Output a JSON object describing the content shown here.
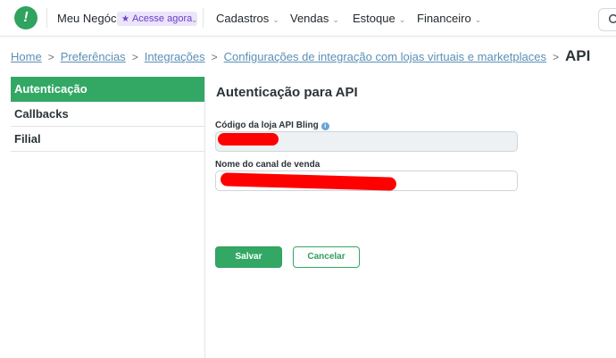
{
  "topnav": {
    "logo_text": "!",
    "items": [
      {
        "label": "Meu Negócio",
        "chevron": "⌄"
      },
      {
        "label": "Cadastros",
        "chevron": "⌄"
      },
      {
        "label": "Vendas",
        "chevron": "⌄"
      },
      {
        "label": "Estoque",
        "chevron": "⌄"
      },
      {
        "label": "Financeiro",
        "chevron": "⌄"
      }
    ],
    "badge": {
      "icon": "star-icon",
      "label": "Acesse agora"
    },
    "search_icon": "search-icon"
  },
  "breadcrumb": {
    "items": [
      "Home",
      "Preferências",
      "Integrações",
      "Configurações de integração com lojas virtuais e marketplaces"
    ],
    "separator": ">",
    "current": "API"
  },
  "sidebar": {
    "items": [
      {
        "label": "Autenticação",
        "active": true
      },
      {
        "label": "Callbacks",
        "active": false
      },
      {
        "label": "Filial",
        "active": false
      }
    ]
  },
  "form": {
    "title": "Autenticação para API",
    "fields": [
      {
        "label": "Código da loja API Bling",
        "has_info_icon": true,
        "value": "",
        "readonly": true
      },
      {
        "label": "Nome do canal de venda",
        "has_info_icon": false,
        "value": "",
        "readonly": false
      }
    ],
    "save_label": "Salvar",
    "cancel_label": "Cancelar"
  },
  "colors": {
    "brand_green": "#33a864",
    "link_blue": "#5b8fb6",
    "badge_purple": "#6a3fc7",
    "redaction_red": "#ff0000"
  }
}
